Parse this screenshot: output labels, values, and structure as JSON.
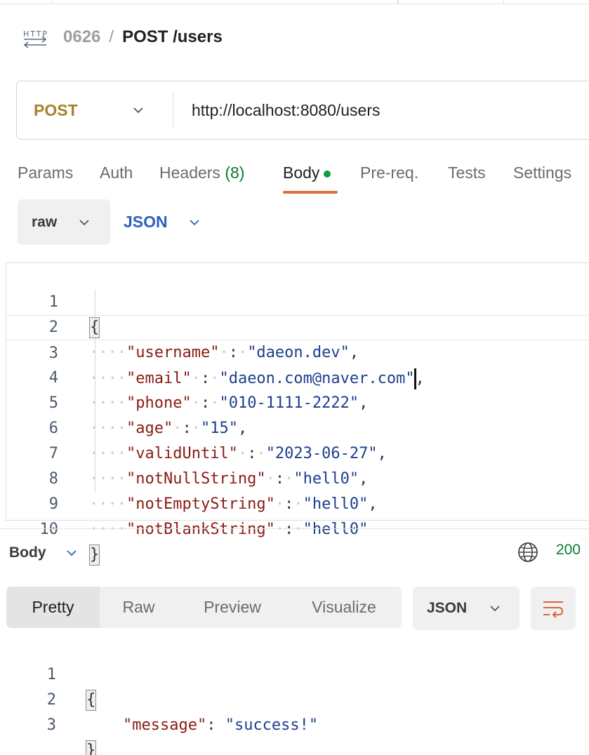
{
  "breadcrumb": {
    "collection": "0626",
    "separator": "/",
    "request_name": "POST /users"
  },
  "request": {
    "method": "POST",
    "url": "http://localhost:8080/users"
  },
  "request_tabs": [
    {
      "label": "Params"
    },
    {
      "label": "Auth"
    },
    {
      "label": "Headers",
      "count": "(8)"
    },
    {
      "label": "Body",
      "active": true
    },
    {
      "label": "Pre-req."
    },
    {
      "label": "Tests"
    },
    {
      "label": "Settings"
    }
  ],
  "body_options": {
    "mode": "raw",
    "language": "JSON"
  },
  "request_body": {
    "line_numbers": [
      "1",
      "2",
      "3",
      "4",
      "5",
      "6",
      "7",
      "8",
      "9",
      "10"
    ],
    "open_brace": "{",
    "close_brace": "}",
    "fields": [
      {
        "key": "\"username\"",
        "value": "\"daeon.dev\"",
        "trail": ","
      },
      {
        "key": "\"email\"",
        "value": "\"daeon.com@naver.com\"",
        "trail": ","
      },
      {
        "key": "\"phone\"",
        "value": "\"010-1111-2222\"",
        "trail": ","
      },
      {
        "key": "\"age\"",
        "value": "\"15\"",
        "trail": ","
      },
      {
        "key": "\"validUntil\"",
        "value": "\"2023-06-27\"",
        "trail": ","
      },
      {
        "key": "\"notNullString\"",
        "value": "\"hell0\"",
        "trail": ","
      },
      {
        "key": "\"notEmptyString\"",
        "value": "\"hell0\"",
        "trail": ","
      },
      {
        "key": "\"notBlankString\"",
        "value": "\"hell0\"",
        "trail": ""
      }
    ]
  },
  "response": {
    "title": "Body",
    "status": "200",
    "view_tabs": [
      "Pretty",
      "Raw",
      "Preview",
      "Visualize"
    ],
    "format": "JSON",
    "line_numbers": [
      "1",
      "2",
      "3"
    ],
    "open_brace": "{",
    "close_brace": "}",
    "key": "\"message\"",
    "colon": ":",
    "value": "\"success!\""
  },
  "colors": {
    "method": "#a7822a",
    "active_tab_underline": "#e2703f",
    "status_ok": "#0a7b32",
    "json_key": "#8a1b14",
    "json_string": "#1e3f8c",
    "language": "#2f5fbe"
  }
}
